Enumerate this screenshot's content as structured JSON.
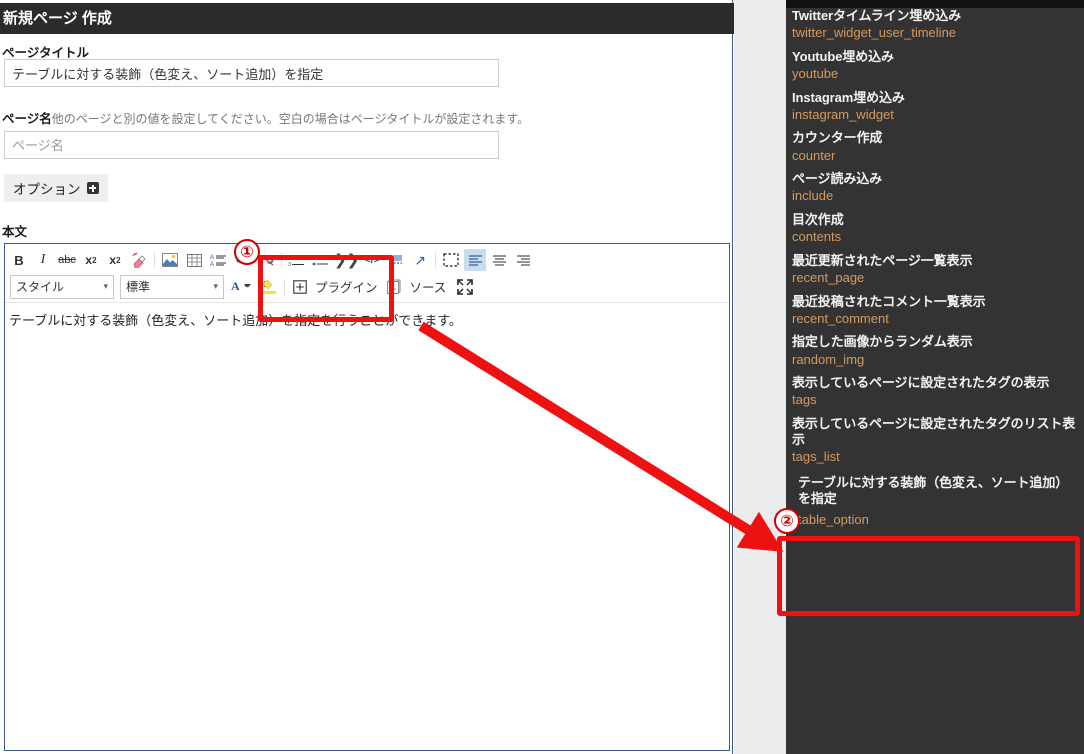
{
  "page": {
    "header_title": "新規ページ 作成"
  },
  "form": {
    "title_label": "ページタイトル",
    "title_value": "テーブルに対する装飾（色変え、ソート追加）を指定",
    "name_label": "ページ名",
    "name_hint": "他のページと別の値を設定してください。空白の場合はページタイトルが設定されます。",
    "name_placeholder": "ページ名",
    "name_value": "",
    "options_label": "オプション",
    "body_label": "本文"
  },
  "toolbar": {
    "row1": [
      {
        "name": "bold-button",
        "glyph": "B",
        "style": "bold"
      },
      {
        "name": "italic-button",
        "glyph": "I",
        "style": "italic"
      },
      {
        "name": "strikethrough-button",
        "glyph": "abc",
        "style": "strike"
      },
      {
        "name": "subscript-button",
        "glyph": "x₂",
        "style": "plain"
      },
      {
        "name": "superscript-button",
        "glyph": "x²",
        "style": "plain"
      },
      {
        "name": "remove-format-button",
        "glyph": "✎",
        "style": "pink"
      },
      {
        "name": "image-button",
        "glyph": "🖼",
        "style": "plain"
      },
      {
        "name": "table-button",
        "glyph": "▦",
        "style": "plain"
      },
      {
        "name": "text-compare-button",
        "glyph": "A≡",
        "style": "blue"
      },
      {
        "name": "link-button",
        "glyph": "⛓",
        "style": "blue"
      },
      {
        "name": "unlink-button",
        "glyph": "⛓",
        "style": "blue"
      },
      {
        "name": "numbered-list-button",
        "glyph": "1≡",
        "style": "blue"
      },
      {
        "name": "bulleted-list-button",
        "glyph": "•≡",
        "style": "blue"
      },
      {
        "name": "blockquote-button",
        "glyph": "❞",
        "style": "plain"
      },
      {
        "name": "code-block-button",
        "glyph": "</>",
        "style": "blue"
      },
      {
        "name": "horizontal-rule-button",
        "glyph": "▥",
        "style": "blue"
      },
      {
        "name": "maximize-arrow-button",
        "glyph": "↗",
        "style": "blue"
      },
      {
        "name": "show-blocks-button",
        "glyph": "⬚",
        "style": "dashed"
      },
      {
        "name": "align-left-button",
        "glyph": "≡",
        "style": "selected"
      },
      {
        "name": "align-center-button",
        "glyph": "≡",
        "style": "plain"
      },
      {
        "name": "align-right-button",
        "glyph": "≡",
        "style": "plain"
      }
    ],
    "style_select": "スタイル",
    "format_select": "標準",
    "text_color_label": "A",
    "bg_color_label": "ab",
    "plugin_label": "プラグイン",
    "source_label": "ソース",
    "maximize_label": "maximize"
  },
  "editor": {
    "body_text": "テーブルに対する装飾（色変え、ソート追加）を指定を行うことができます。"
  },
  "sidebar": {
    "items": [
      {
        "title": "Twitterタイムライン埋め込み",
        "code": "twitter_widget_user_timeline"
      },
      {
        "title": "Youtube埋め込み",
        "code": "youtube"
      },
      {
        "title": "Instagram埋め込み",
        "code": "instagram_widget"
      },
      {
        "title": "カウンター作成",
        "code": "counter"
      },
      {
        "title": "ページ読み込み",
        "code": "include"
      },
      {
        "title": "目次作成",
        "code": "contents"
      },
      {
        "title": "最近更新されたページ一覧表示",
        "code": "recent_page"
      },
      {
        "title": "最近投稿されたコメント一覧表示",
        "code": "recent_comment"
      },
      {
        "title": "指定した画像からランダム表示",
        "code": "random_img"
      },
      {
        "title": "表示しているページに設定されたタグの表示",
        "code": "tags"
      },
      {
        "title": "表示しているページに設定されたタグのリスト表示",
        "code": "tags_list"
      },
      {
        "title": "テーブルに対する装飾（色変え、ソート追加）を指定",
        "code": "table_option"
      }
    ]
  },
  "annotations": {
    "marker_one": "①",
    "marker_two": "②"
  },
  "colors": {
    "header_bg": "#2b2b2b",
    "sidebar_bg": "#333333",
    "sidebar_code": "#d79a5e",
    "annotation_red": "#ee1111",
    "editor_border": "#3c5a8a",
    "gutter_gray": "#ececec"
  }
}
